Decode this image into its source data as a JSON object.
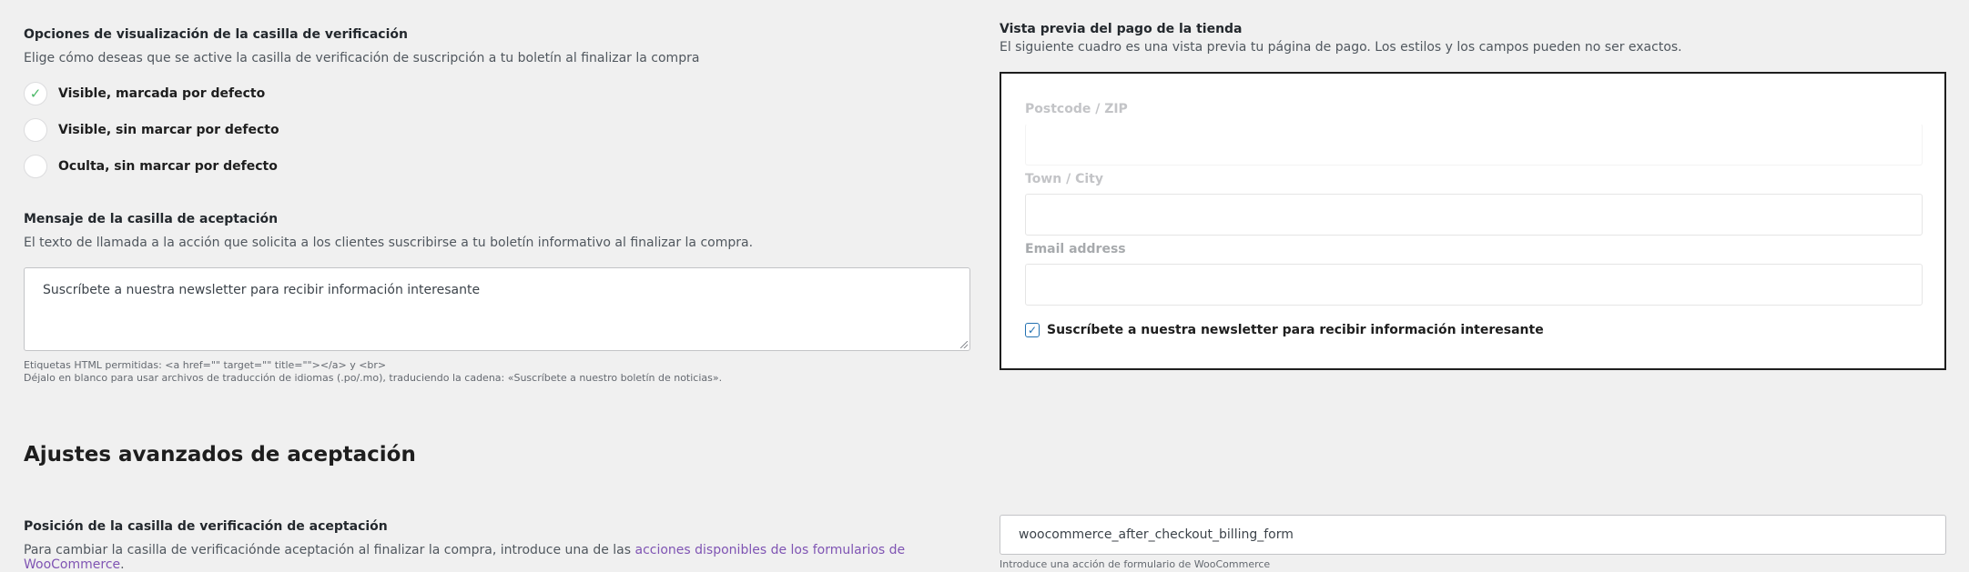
{
  "display_options": {
    "title": "Opciones de visualización de la casilla de verificación",
    "description": "Elige cómo deseas que se active la casilla de verificación de suscripción a tu boletín al finalizar la compra",
    "options": [
      {
        "label": "Visible, marcada por defecto",
        "selected": true
      },
      {
        "label": "Visible, sin marcar por defecto",
        "selected": false
      },
      {
        "label": "Oculta, sin marcar por defecto",
        "selected": false
      }
    ],
    "check_glyph": "✓"
  },
  "accept_message": {
    "title": "Mensaje de la casilla de aceptación",
    "description": "El texto de llamada a la acción que solicita a los clientes suscribirse a tu boletín informativo al finalizar la compra.",
    "value": "Suscríbete a nuestra newsletter para recibir información interesante",
    "help_tags": "Etiquetas HTML permitidas: <a href=\"\" target=\"\" title=\"\"></a> y <br>",
    "help_translation": "Déjalo en blanco para usar archivos de traducción de idiomas (.po/.mo), traduciendo la cadena: «Suscríbete a nuestro boletín de noticias»."
  },
  "advanced": {
    "title": "Ajustes avanzados de aceptación",
    "position_title": "Posición de la casilla de verificación de aceptación",
    "position_desc_prefix": "Para cambiar la casilla de verificaciónde aceptación al finalizar la compra, introduce una de las ",
    "position_desc_link": "acciones disponibles de los formularios de WooCommerce",
    "position_desc_suffix": ".",
    "hook_value": "woocommerce_after_checkout_billing_form",
    "hook_help": "Introduce una acción de formulario de WooCommerce"
  },
  "preview": {
    "title": "Vista previa del pago de la tienda",
    "description": "El siguiente cuadro es una vista previa tu página de pago. Los estilos y los campos pueden no ser exactos.",
    "fields": [
      {
        "label": "Postcode / ZIP"
      },
      {
        "label": "Town / City"
      },
      {
        "label": "Email address"
      }
    ],
    "checkbox_label": "Suscríbete a nuestra newsletter para recibir información interesante",
    "checkbox_glyph": "✓"
  }
}
